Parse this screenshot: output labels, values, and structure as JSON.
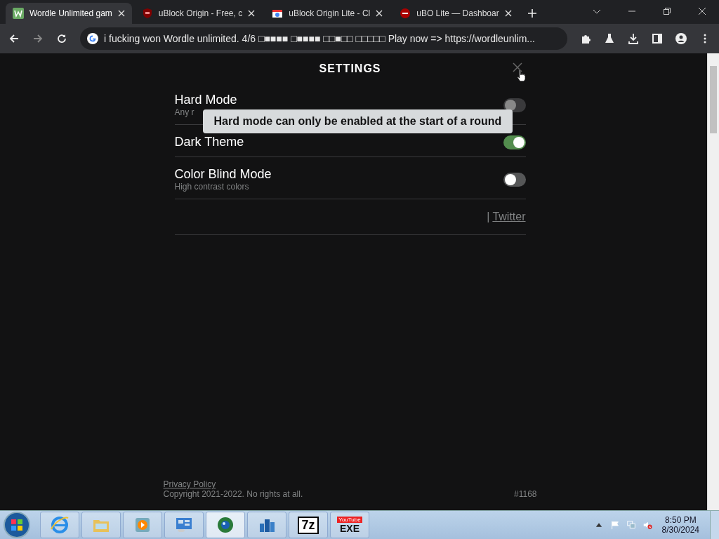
{
  "browser": {
    "tabs": [
      {
        "title": "Wordle Unlimited gam",
        "kind": "wordle",
        "selected": true
      },
      {
        "title": "uBlock Origin - Free, c",
        "kind": "ublock",
        "selected": false
      },
      {
        "title": "uBlock Origin Lite - Cl",
        "kind": "store",
        "selected": false
      },
      {
        "title": "uBO Lite — Dashboar",
        "kind": "ubolite",
        "selected": false
      }
    ],
    "address": "i fucking won Wordle unlimited. 4/6 □■■■■ □■■■■ □□■□□ □□□□□ Play now => https://wordleunlim..."
  },
  "settings": {
    "title": "SETTINGS",
    "options": [
      {
        "label": "Hard Mode",
        "description": "Any r",
        "on": false,
        "disabled": true
      },
      {
        "label": "Dark Theme",
        "on": true,
        "disabled": false
      },
      {
        "label": "Color Blind Mode",
        "description": "High contrast colors",
        "on": false,
        "disabled": false
      }
    ],
    "tooltip": "Hard mode can only be enabled at the start of a round",
    "separator": "|",
    "link": "Twitter"
  },
  "footer": {
    "privacy": "Privacy Policy",
    "copyright": "Copyright 2021-2022. No rights at all.",
    "game_number": "#1168"
  },
  "taskbar": {
    "apps": [
      {
        "kind": "ie",
        "selected": false
      },
      {
        "kind": "folder",
        "selected": false
      },
      {
        "kind": "media",
        "selected": false
      },
      {
        "kind": "panel",
        "selected": false
      },
      {
        "kind": "globe",
        "selected": true
      },
      {
        "kind": "tower",
        "selected": false
      },
      {
        "kind": "sevenzip",
        "label": "7z",
        "selected": false
      },
      {
        "kind": "youtube",
        "badge": "YouTube",
        "label": "EXE",
        "selected": false
      }
    ],
    "time": "8:50 PM",
    "date": "8/30/2024"
  }
}
